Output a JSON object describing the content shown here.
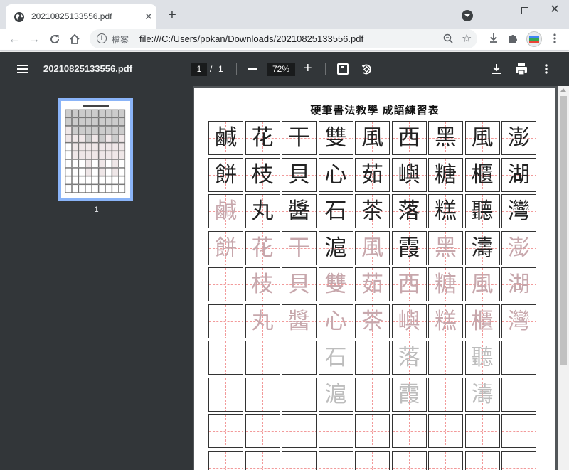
{
  "tab": {
    "title": "20210825133556.pdf",
    "favicon": "globe-icon"
  },
  "window": {
    "minimize": "minimize",
    "maximize": "maximize",
    "close": "✕"
  },
  "address": {
    "site_label": "檔案",
    "url": "file:///C:/Users/pokan/Downloads/20210825133556.pdf"
  },
  "pdf": {
    "file_title": "20210825133556.pdf",
    "page_current": "1",
    "page_separator": "/",
    "page_total": "1",
    "zoom": "72%",
    "thumbnail_label": "1"
  },
  "sheet": {
    "title": "硬筆書法教學 成語練習表",
    "rows": [
      [
        {
          "c": "鹹",
          "s": "solid"
        },
        {
          "c": "花",
          "s": "solid"
        },
        {
          "c": "干",
          "s": "solid"
        },
        {
          "c": "雙",
          "s": "solid"
        },
        {
          "c": "風",
          "s": "solid"
        },
        {
          "c": "西",
          "s": "solid"
        },
        {
          "c": "黑",
          "s": "solid"
        },
        {
          "c": "風",
          "s": "solid"
        },
        {
          "c": "澎",
          "s": "solid"
        }
      ],
      [
        {
          "c": "餅",
          "s": "solid"
        },
        {
          "c": "枝",
          "s": "solid"
        },
        {
          "c": "貝",
          "s": "solid"
        },
        {
          "c": "心",
          "s": "solid"
        },
        {
          "c": "茹",
          "s": "solid"
        },
        {
          "c": "嶼",
          "s": "solid"
        },
        {
          "c": "糖",
          "s": "solid"
        },
        {
          "c": "櫃",
          "s": "solid"
        },
        {
          "c": "湖",
          "s": "solid"
        }
      ],
      [
        {
          "c": "鹹",
          "s": "trace1"
        },
        {
          "c": "丸",
          "s": "solid"
        },
        {
          "c": "醬",
          "s": "solid"
        },
        {
          "c": "石",
          "s": "solid"
        },
        {
          "c": "茶",
          "s": "solid"
        },
        {
          "c": "落",
          "s": "solid"
        },
        {
          "c": "糕",
          "s": "solid"
        },
        {
          "c": "聽",
          "s": "solid"
        },
        {
          "c": "灣",
          "s": "solid"
        }
      ],
      [
        {
          "c": "餅",
          "s": "trace1"
        },
        {
          "c": "花",
          "s": "trace1"
        },
        {
          "c": "干",
          "s": "trace1"
        },
        {
          "c": "滬",
          "s": "solid"
        },
        {
          "c": "風",
          "s": "trace1"
        },
        {
          "c": "霞",
          "s": "solid"
        },
        {
          "c": "黑",
          "s": "trace1"
        },
        {
          "c": "濤",
          "s": "solid"
        },
        {
          "c": "澎",
          "s": "trace1"
        }
      ],
      [
        {
          "c": "",
          "s": ""
        },
        {
          "c": "枝",
          "s": "trace1"
        },
        {
          "c": "貝",
          "s": "trace1"
        },
        {
          "c": "雙",
          "s": "trace1"
        },
        {
          "c": "茹",
          "s": "trace1"
        },
        {
          "c": "西",
          "s": "trace1"
        },
        {
          "c": "糖",
          "s": "trace1"
        },
        {
          "c": "風",
          "s": "trace1"
        },
        {
          "c": "湖",
          "s": "trace1"
        }
      ],
      [
        {
          "c": "",
          "s": ""
        },
        {
          "c": "丸",
          "s": "trace1"
        },
        {
          "c": "醬",
          "s": "trace1"
        },
        {
          "c": "心",
          "s": "trace1"
        },
        {
          "c": "茶",
          "s": "trace1"
        },
        {
          "c": "嶼",
          "s": "trace1"
        },
        {
          "c": "糕",
          "s": "trace1"
        },
        {
          "c": "櫃",
          "s": "trace1"
        },
        {
          "c": "灣",
          "s": "trace1"
        }
      ],
      [
        {
          "c": "",
          "s": ""
        },
        {
          "c": "",
          "s": ""
        },
        {
          "c": "",
          "s": ""
        },
        {
          "c": "石",
          "s": "trace2"
        },
        {
          "c": "",
          "s": ""
        },
        {
          "c": "落",
          "s": "trace2"
        },
        {
          "c": "",
          "s": ""
        },
        {
          "c": "聽",
          "s": "trace2"
        },
        {
          "c": "",
          "s": ""
        }
      ],
      [
        {
          "c": "",
          "s": ""
        },
        {
          "c": "",
          "s": ""
        },
        {
          "c": "",
          "s": ""
        },
        {
          "c": "滬",
          "s": "trace2"
        },
        {
          "c": "",
          "s": ""
        },
        {
          "c": "霞",
          "s": "trace2"
        },
        {
          "c": "",
          "s": ""
        },
        {
          "c": "濤",
          "s": "trace2"
        },
        {
          "c": "",
          "s": ""
        }
      ],
      [
        {
          "c": "",
          "s": ""
        },
        {
          "c": "",
          "s": ""
        },
        {
          "c": "",
          "s": ""
        },
        {
          "c": "",
          "s": ""
        },
        {
          "c": "",
          "s": ""
        },
        {
          "c": "",
          "s": ""
        },
        {
          "c": "",
          "s": ""
        },
        {
          "c": "",
          "s": ""
        },
        {
          "c": "",
          "s": ""
        }
      ],
      [
        {
          "c": "",
          "s": ""
        },
        {
          "c": "",
          "s": ""
        },
        {
          "c": "",
          "s": ""
        },
        {
          "c": "",
          "s": ""
        },
        {
          "c": "",
          "s": ""
        },
        {
          "c": "",
          "s": ""
        },
        {
          "c": "",
          "s": ""
        },
        {
          "c": "",
          "s": ""
        },
        {
          "c": "",
          "s": ""
        }
      ]
    ]
  },
  "colors": {
    "tabstrip": "#dee1e6",
    "pdf_toolbar": "#323639",
    "viewer_bg": "#525659",
    "thumb_border": "#8ab4f8",
    "guide_line": "#f29a9a"
  },
  "icons": [
    "globe-icon",
    "close-icon",
    "plus-icon",
    "tab-search-icon",
    "back-arrow-icon",
    "forward-arrow-icon",
    "reload-icon",
    "home-icon",
    "info-icon",
    "zoom-icon",
    "star-icon",
    "download-icon",
    "extensions-icon",
    "avatar",
    "more-vert-icon",
    "menu-icon",
    "fit-page-icon",
    "rotate-icon",
    "print-icon"
  ]
}
